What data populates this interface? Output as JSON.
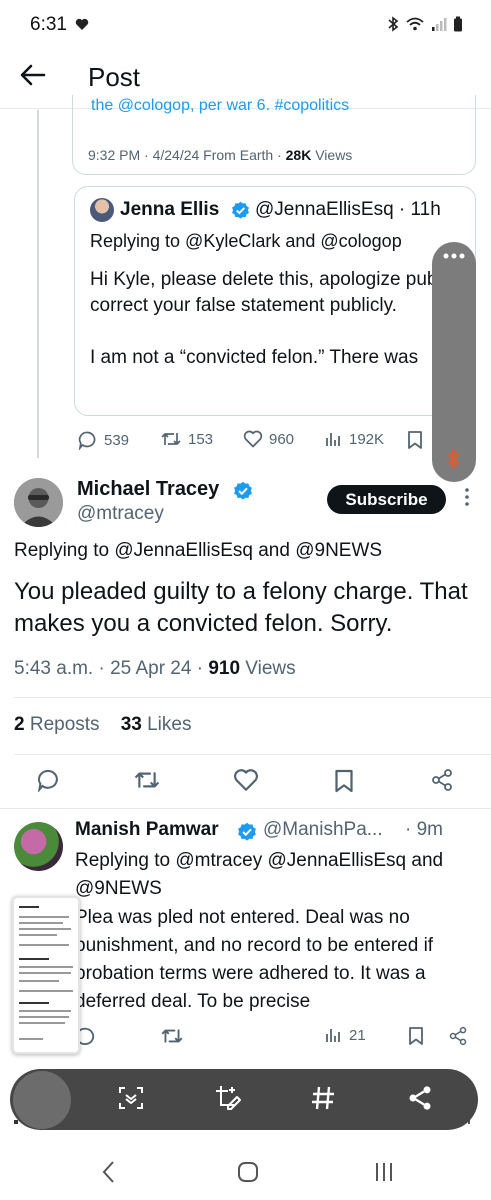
{
  "status_bar": {
    "time": "6:31"
  },
  "header": {
    "title": "Post"
  },
  "quoted_top": {
    "text_fragment": "the @cologop, per war 6. #copolitics",
    "time": "9:32 PM · 4/24/24 From Earth · ",
    "views_count": "28K",
    "views_label": " Views"
  },
  "quoted_post": {
    "name": "Jenna Ellis",
    "handle": "@JennaEllisEsq · 11h",
    "replying": "Replying to @KyleClark and @cologop",
    "body": "Hi Kyle, please delete this, apologize publicly, and correct your false statement publicly.\n\nI am not a “convicted felon.” There was"
  },
  "parent_actions": {
    "replies": "539",
    "reposts": "153",
    "likes": "960",
    "views": "192K"
  },
  "main_post": {
    "name": "Michael Tracey",
    "handle": "@mtracey",
    "subscribe_label": "Subscribe",
    "replying": "Replying to @JennaEllisEsq and @9NEWS",
    "text": "You pleaded guilty to a felony charge. That makes you a convicted felon. Sorry.",
    "time": "5:43 a.m. · 25 Apr 24 · ",
    "views_count": "910",
    "views_label": " Views",
    "reposts_count": "2",
    "reposts_label": " Reposts",
    "likes_count": "33",
    "likes_label": " Likes"
  },
  "reply_post": {
    "name": "Manish Pamwar",
    "handle": "@ManishPa...",
    "time": "· 9m",
    "replying": "Replying to @mtracey @JennaEllisEsq and @9NEWS",
    "body": "Plea was pled not entered. Deal was no punishment, and no record to be entered if probation terms were adhered to. It was a deferred deal. To be precise",
    "views": "21"
  },
  "toolbar": {
    "hashtag_label": "#"
  },
  "icons": {
    "back": "arrow-left-icon",
    "verified": "verified-badge-icon",
    "reply": "comment-icon",
    "repost": "repost-icon",
    "like": "heart-icon",
    "views": "bar-chart-icon",
    "bookmark": "bookmark-icon",
    "share": "share-icon"
  },
  "colors": {
    "accent": "#1d9bf0",
    "text": "#0f1419",
    "muted": "#536471",
    "toolbar": "#474747"
  }
}
